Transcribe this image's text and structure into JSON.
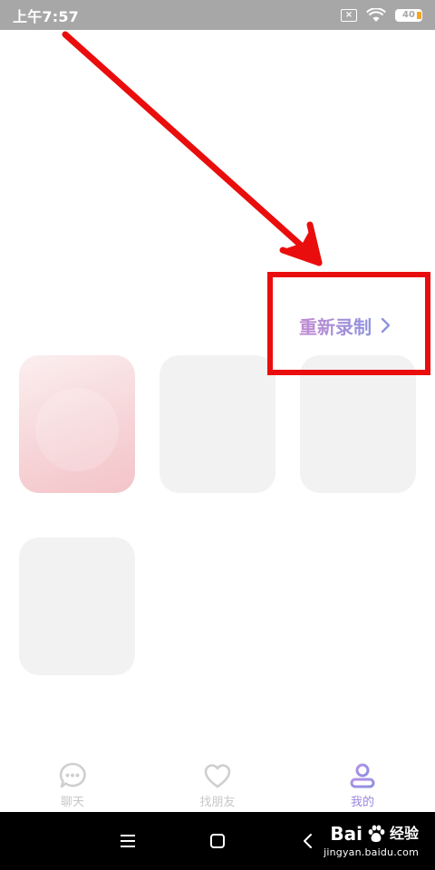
{
  "status_bar": {
    "time": "上午7:57",
    "battery_level": "40",
    "icons": [
      "sim-none-icon",
      "wifi-icon",
      "battery-icon"
    ]
  },
  "main": {
    "re_record_label": "重新录制",
    "photo_slots_count_visible": 4
  },
  "tabs": [
    {
      "label": "聊天",
      "icon": "chat-bubble-icon",
      "active": false
    },
    {
      "label": "找朋友",
      "icon": "heart-icon",
      "active": false
    },
    {
      "label": "我的",
      "icon": "profile-icon",
      "active": true
    }
  ],
  "nav_bar": {
    "icons": [
      "menu-icon",
      "home-icon",
      "back-icon"
    ]
  },
  "watermark": {
    "brand": "Bai",
    "brand_tail": "经验",
    "url": "jingyan.baidu.com"
  },
  "colors": {
    "status_bar_bg": "#a7a7a7",
    "accent_purple": "#9b86e0",
    "annotation_red": "#ea0d0d",
    "slot_gray": "#f2f2f2",
    "slot_pink": "#f6d3d6"
  }
}
